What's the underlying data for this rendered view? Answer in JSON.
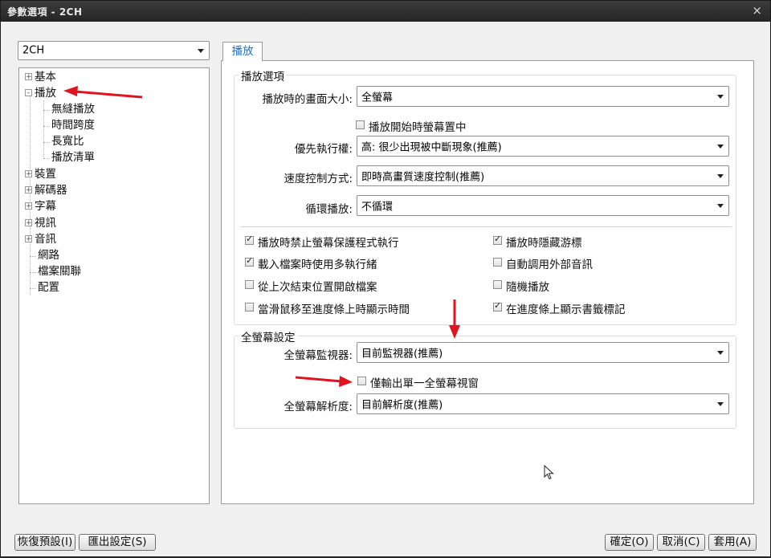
{
  "window": {
    "title": "參數選項 - 2CH",
    "close_glyph": "×"
  },
  "profile_combo": {
    "value": "2CH"
  },
  "tree": {
    "items": [
      {
        "label": "基本",
        "expander": "+"
      },
      {
        "label": "播放",
        "expander": "-"
      },
      {
        "label": "無縫播放"
      },
      {
        "label": "時間跨度"
      },
      {
        "label": "長寬比"
      },
      {
        "label": "播放清單"
      },
      {
        "label": "裝置",
        "expander": "+"
      },
      {
        "label": "解碼器",
        "expander": "+"
      },
      {
        "label": "字幕",
        "expander": "+"
      },
      {
        "label": "視訊",
        "expander": "+"
      },
      {
        "label": "音訊",
        "expander": "+"
      },
      {
        "label": "網路"
      },
      {
        "label": "檔案關聯"
      },
      {
        "label": "配置"
      }
    ]
  },
  "tab": {
    "label": "播放"
  },
  "playback_group": {
    "title": "播放選項",
    "screen_size_label": "播放時的畫面大小:",
    "screen_size_value": "全螢幕",
    "center_checkbox_label": "播放開始時螢幕置中",
    "priority_label": "優先執行權:",
    "priority_value": "高: 很少出現被中斷現象(推薦)",
    "speed_label": "速度控制方式:",
    "speed_value": "即時高畫質速度控制(推薦)",
    "loop_label": "循環播放:",
    "loop_value": "不循環",
    "checkboxes": [
      {
        "label": "播放時禁止螢幕保護程式執行",
        "checked": true
      },
      {
        "label": "播放時隱藏游標",
        "checked": true
      },
      {
        "label": "載入檔案時使用多執行緒",
        "checked": true
      },
      {
        "label": "自動調用外部音訊",
        "checked": false
      },
      {
        "label": "從上次結束位置開啟檔案",
        "checked": false
      },
      {
        "label": "隨機播放",
        "checked": false
      },
      {
        "label": "當滑鼠移至進度條上時顯示時間",
        "checked": false
      },
      {
        "label": "在進度條上顯示書籤標記",
        "checked": true
      }
    ]
  },
  "fullscreen_group": {
    "title": "全螢幕設定",
    "monitor_label": "全螢幕監視器:",
    "monitor_value": "目前監視器(推薦)",
    "single_window_label": "僅輸出單一全螢幕視窗",
    "resolution_label": "全螢幕解析度:",
    "resolution_value": "目前解析度(推薦)"
  },
  "buttons": {
    "reset": "恢復預設(I)",
    "export": "匯出設定(S)",
    "ok": "確定(O)",
    "cancel": "取消(C)",
    "apply": "套用(A)"
  },
  "colors": {
    "accent": "#1e6ec0",
    "annotation": "#e0141e"
  }
}
